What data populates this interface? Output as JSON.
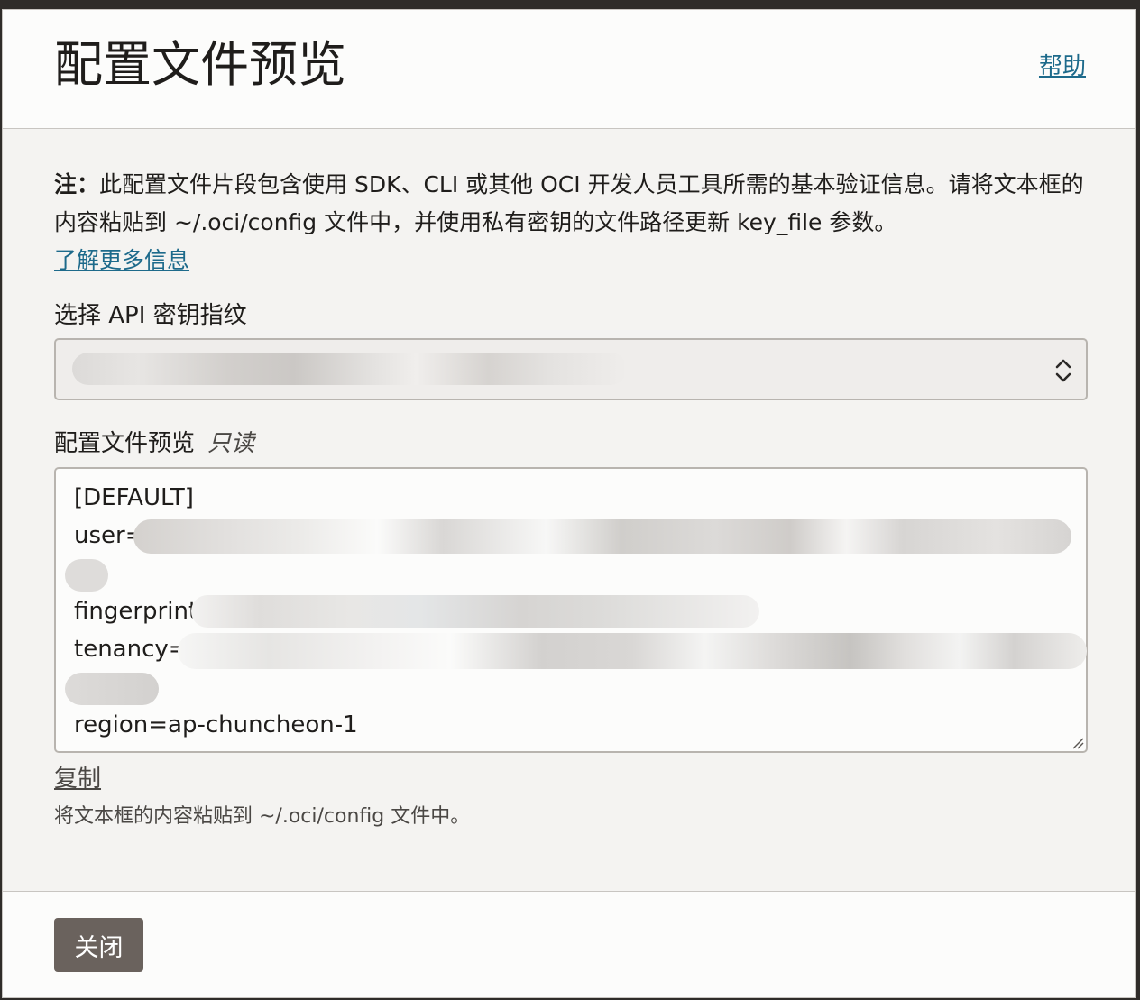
{
  "header": {
    "title": "配置文件预览",
    "help_label": "帮助"
  },
  "note": {
    "prefix": "注：",
    "text": "此配置文件片段包含使用 SDK、CLI 或其他 OCI 开发人员工具所需的基本验证信息。请将文本框的内容粘贴到 ~/.oci/config 文件中，并使用私有密钥的文件路径更新 key_file 参数。",
    "learn_more": "了解更多信息"
  },
  "fingerprint_select": {
    "label": "选择 API 密钥指纹",
    "value": ""
  },
  "preview": {
    "label": "配置文件预览",
    "readonly_tag": "只读",
    "lines": {
      "section": "[DEFAULT]",
      "user": "user=",
      "fingerprint": "fingerprint=",
      "tenancy": "tenancy=",
      "region": "region=ap-chuncheon-1"
    }
  },
  "actions": {
    "copy_label": "复制",
    "hint": "将文本框的内容粘贴到 ~/.oci/config 文件中。"
  },
  "footer": {
    "close_label": "关闭"
  }
}
